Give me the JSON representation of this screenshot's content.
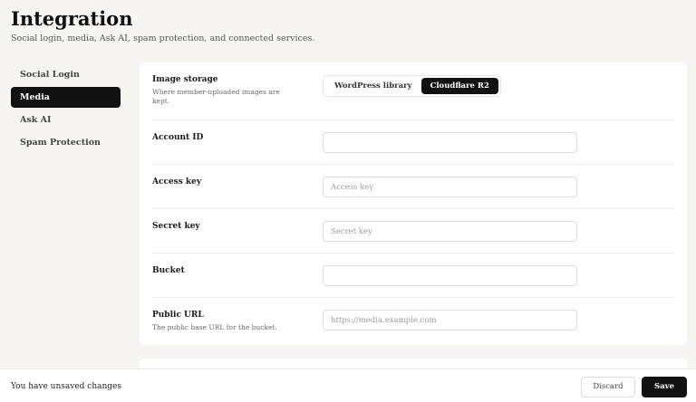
{
  "header": {
    "title": "Integration",
    "subtitle": "Social login, media, Ask AI, spam protection, and connected services."
  },
  "sidebar": {
    "items": [
      {
        "label": "Social Login"
      },
      {
        "label": "Media"
      },
      {
        "label": "Ask AI"
      },
      {
        "label": "Spam Protection"
      }
    ],
    "active": "Media"
  },
  "media": {
    "image_storage": {
      "label": "Image storage",
      "help": "Where member-uploaded images are kept.",
      "options": [
        "WordPress library",
        "Cloudflare R2"
      ],
      "selected": "Cloudflare R2"
    },
    "account_id": {
      "label": "Account ID",
      "value": "",
      "placeholder": ""
    },
    "access_key": {
      "label": "Access key",
      "value": "",
      "placeholder": "Access key"
    },
    "secret_key": {
      "label": "Secret key",
      "value": "",
      "placeholder": "Secret key"
    },
    "bucket": {
      "label": "Bucket",
      "value": "",
      "placeholder": ""
    },
    "public_url": {
      "label": "Public URL",
      "help": "The public base URL for the bucket.",
      "value": "",
      "placeholder": "https://media.example.com"
    }
  },
  "footer": {
    "status": "You have unsaved changes",
    "discard_label": "Discard",
    "save_label": "Save"
  }
}
